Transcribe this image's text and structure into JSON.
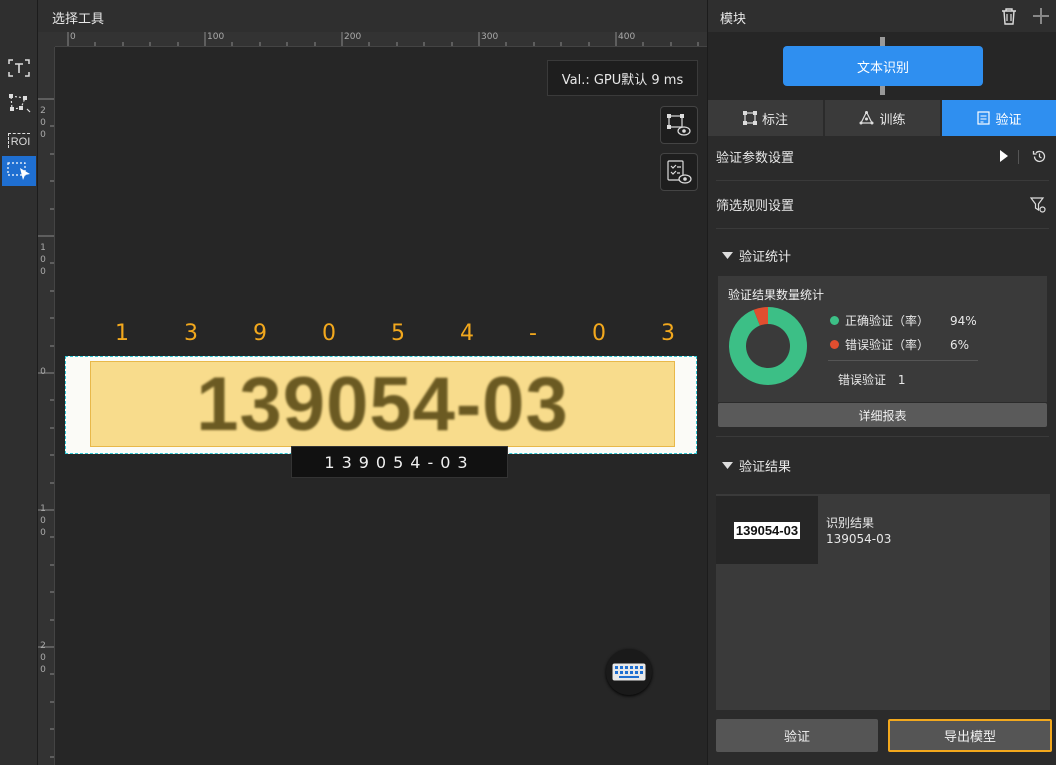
{
  "toolbar": {
    "title": "选择工具",
    "tools": [
      "text-tool-icon",
      "polygon-tool-icon",
      "roi-tool-icon",
      "select-tool-icon"
    ],
    "roi_label": "ROI"
  },
  "ruler": {
    "h_marks": [
      "0",
      "100",
      "200",
      "300",
      "400"
    ],
    "v_marks": [
      [
        "2",
        "0",
        "0"
      ],
      [
        "1",
        "0",
        "0"
      ],
      [
        "0"
      ],
      [
        "1",
        "0",
        "0"
      ],
      [
        "2",
        "0",
        "0"
      ]
    ]
  },
  "canvas": {
    "val_info": "Val.:  GPU默认 9 ms",
    "predicted_chars": [
      "1",
      "3",
      "9",
      "0",
      "5",
      "4",
      "-",
      "0",
      "3"
    ],
    "image_text": "139054-03",
    "label_text": "139054-03"
  },
  "panel": {
    "title": "模块",
    "module_name": "文本识别",
    "tabs": [
      {
        "label": "标注",
        "icon": "annotate-icon"
      },
      {
        "label": "训练",
        "icon": "train-icon"
      },
      {
        "label": "验证",
        "icon": "validate-icon"
      }
    ],
    "val_params": "验证参数设置",
    "filter_rules": "筛选规则设置",
    "stats_section": "验证统计",
    "stats_title": "验证结果数量统计",
    "correct_label": "正确验证（率）",
    "correct_pct": "94%",
    "error_label": "错误验证（率）",
    "error_pct": "6%",
    "error_count_label": "错误验证",
    "error_count": "1",
    "report_button": "详细报表",
    "results_section": "验证结果",
    "result_title": "识别结果",
    "result_value": "139054-03",
    "thumb_text": "139054-03",
    "validate_button": "验证",
    "export_button": "导出模型"
  },
  "colors": {
    "accent": "#2f8ff0",
    "correct": "#3cbf86",
    "error": "#e04e2f",
    "highlight": "#f2a81d"
  },
  "chart_data": {
    "type": "pie",
    "categories": [
      "正确验证（率）",
      "错误验证（率）"
    ],
    "values": [
      94,
      6
    ],
    "title": "验证结果数量统计"
  }
}
